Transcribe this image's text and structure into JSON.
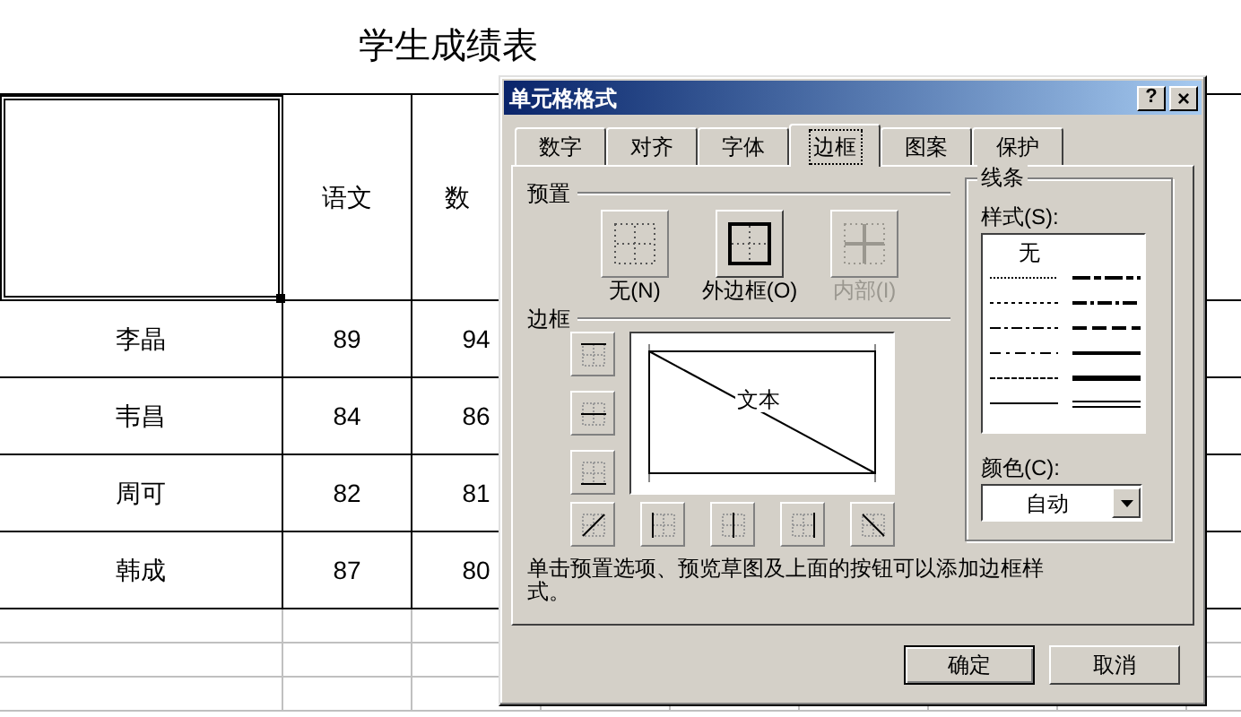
{
  "sheet": {
    "title": "学生成绩表",
    "header": {
      "col_2": "语文",
      "col_3": "数"
    },
    "rows": [
      {
        "name": "李晶",
        "col_2": "89",
        "col_3": "94"
      },
      {
        "name": "韦昌",
        "col_2": "84",
        "col_3": "86"
      },
      {
        "name": "周可",
        "col_2": "82",
        "col_3": "81"
      },
      {
        "name": "韩成",
        "col_2": "87",
        "col_3": "80"
      }
    ]
  },
  "dialog": {
    "title": "单元格格式",
    "help_button": "?",
    "close_button": "×",
    "tabs": [
      {
        "label": "数字",
        "selected": false
      },
      {
        "label": "对齐",
        "selected": false
      },
      {
        "label": "字体",
        "selected": false
      },
      {
        "label": "边框",
        "selected": true
      },
      {
        "label": "图案",
        "selected": false
      },
      {
        "label": "保护",
        "selected": false
      }
    ],
    "presets_label": "预置",
    "presets": [
      {
        "label": "无(N)",
        "kind": "none",
        "disabled": false
      },
      {
        "label": "外边框(O)",
        "kind": "outline",
        "disabled": false
      },
      {
        "label": "内部(I)",
        "kind": "inside",
        "disabled": true
      }
    ],
    "border_label": "边框",
    "preview_text": "文本",
    "hint": "单击预置选项、预览草图及上面的按钮可以添加边框样式。",
    "line_group_label": "线条",
    "style_label": "样式(S):",
    "style_none": "无",
    "color_label": "颜色(C):",
    "color_value": "自动",
    "buttons": [
      {
        "label": "确定",
        "default": true
      },
      {
        "label": "取消",
        "default": false
      }
    ]
  }
}
